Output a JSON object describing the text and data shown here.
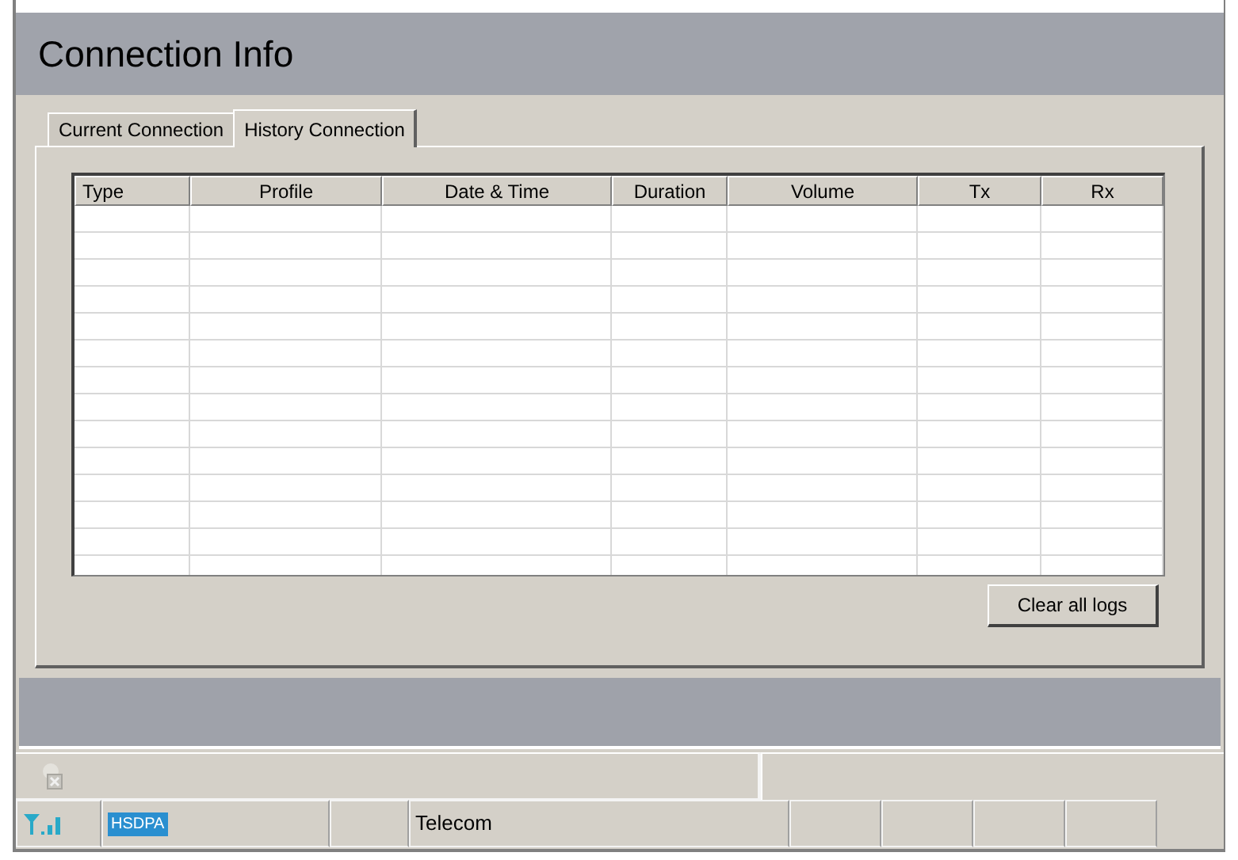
{
  "header": {
    "title": "Connection Info"
  },
  "tabs": [
    {
      "label": "Current Connection",
      "selected": false
    },
    {
      "label": "History Connection",
      "selected": true
    }
  ],
  "table": {
    "columns": [
      "Type",
      "Profile",
      "Date & Time",
      "Duration",
      "Volume",
      "Tx",
      "Rx"
    ]
  },
  "clear_button": "Clear all logs",
  "status_bar": {
    "network_type": "HSDPA",
    "operator": "Telecom"
  }
}
